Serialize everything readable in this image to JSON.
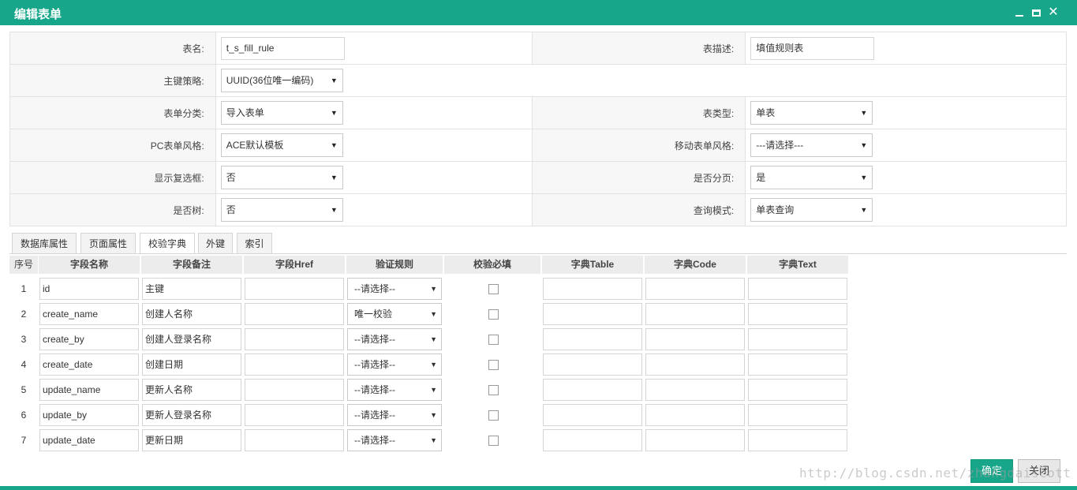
{
  "window": {
    "title": "编辑表单"
  },
  "form": {
    "table_name_label": "表名:",
    "table_name_value": "t_s_fill_rule",
    "table_desc_label": "表描述:",
    "table_desc_value": "填值规则表",
    "pk_strategy_label": "主键策略:",
    "pk_strategy_value": "UUID(36位唯一编码)",
    "category_label": "表单分类:",
    "category_value": "导入表单",
    "table_type_label": "表类型:",
    "table_type_value": "单表",
    "pc_style_label": "PC表单风格:",
    "pc_style_value": "ACE默认模板",
    "mobile_style_label": "移动表单风格:",
    "mobile_style_value": "---请选择---",
    "show_checkbox_label": "显示复选框:",
    "show_checkbox_value": "否",
    "paging_label": "是否分页:",
    "paging_value": "是",
    "tree_label": "是否树:",
    "tree_value": "否",
    "query_mode_label": "查询模式:",
    "query_mode_value": "单表查询"
  },
  "tabs": [
    "数据库属性",
    "页面属性",
    "校验字典",
    "外键",
    "索引"
  ],
  "grid": {
    "headers": [
      "序号",
      "字段名称",
      "字段备注",
      "字段Href",
      "验证规则",
      "校验必填",
      "字典Table",
      "字典Code",
      "字典Text"
    ],
    "rows": [
      {
        "num": "1",
        "name": "id",
        "remark": "主键",
        "href": "",
        "rule": "--请选择--",
        "required": false,
        "dict_table": "",
        "dict_code": "",
        "dict_text": ""
      },
      {
        "num": "2",
        "name": "create_name",
        "remark": "创建人名称",
        "href": "",
        "rule": "唯一校验",
        "required": false,
        "dict_table": "",
        "dict_code": "",
        "dict_text": ""
      },
      {
        "num": "3",
        "name": "create_by",
        "remark": "创建人登录名称",
        "href": "",
        "rule": "--请选择--",
        "required": false,
        "dict_table": "",
        "dict_code": "",
        "dict_text": ""
      },
      {
        "num": "4",
        "name": "create_date",
        "remark": "创建日期",
        "href": "",
        "rule": "--请选择--",
        "required": false,
        "dict_table": "",
        "dict_code": "",
        "dict_text": ""
      },
      {
        "num": "5",
        "name": "update_name",
        "remark": "更新人名称",
        "href": "",
        "rule": "--请选择--",
        "required": false,
        "dict_table": "",
        "dict_code": "",
        "dict_text": ""
      },
      {
        "num": "6",
        "name": "update_by",
        "remark": "更新人登录名称",
        "href": "",
        "rule": "--请选择--",
        "required": false,
        "dict_table": "",
        "dict_code": "",
        "dict_text": ""
      },
      {
        "num": "7",
        "name": "update_date",
        "remark": "更新日期",
        "href": "",
        "rule": "--请选择--",
        "required": false,
        "dict_table": "",
        "dict_code": "",
        "dict_text": ""
      }
    ]
  },
  "buttons": {
    "ok": "确定",
    "cancel": "关闭"
  },
  "watermark": "http://blog.csdn.net/zhangdaiscott",
  "colors": {
    "accent": "#17a689"
  }
}
